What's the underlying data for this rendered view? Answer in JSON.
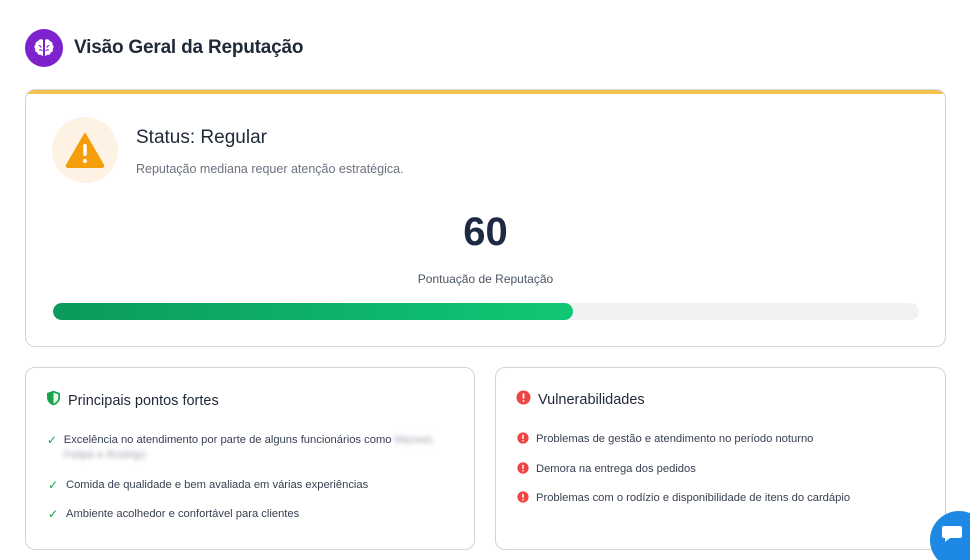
{
  "header": {
    "title": "Visão Geral da Reputação",
    "icon": "brain-icon"
  },
  "status": {
    "title": "Status: Regular",
    "description": "Reputação mediana requer atenção estratégica.",
    "score": "60",
    "score_label": "Pontuação de Reputação",
    "progress_percent": 60,
    "accent_color": "#f4c04c",
    "icon": "warning-icon"
  },
  "strengths": {
    "title": "Principais pontos fortes",
    "icon": "shield-icon",
    "items": [
      {
        "text": "Excelência no atendimento por parte de alguns funcionários como",
        "redacted": "Manoel, Felipe e Rodrigo"
      },
      {
        "text": "Comida de qualidade e bem avaliada em várias experiências"
      },
      {
        "text": "Ambiente acolhedor e confortável para clientes"
      }
    ]
  },
  "vulnerabilities": {
    "title": "Vulnerabilidades",
    "icon": "alert-circle-icon",
    "items": [
      {
        "text": "Problemas de gestão e atendimento no período noturno"
      },
      {
        "text": "Demora na entrega dos pedidos"
      },
      {
        "text": "Problemas com o rodízio e disponibilidade de itens do cardápio"
      }
    ]
  },
  "colors": {
    "brand": "#7e22ce",
    "success": "#16a34a",
    "danger": "#ef4444",
    "chat": "#1e88e5"
  },
  "chat": {
    "icon": "chat-icon"
  }
}
